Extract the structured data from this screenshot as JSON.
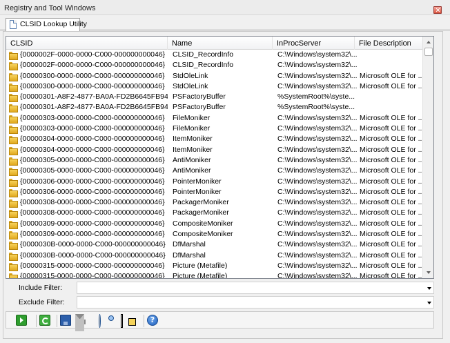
{
  "window": {
    "title": "Registry and Tool Windows"
  },
  "tabs": [
    {
      "label": "CLSID Lookup Utility"
    }
  ],
  "grid": {
    "columns": [
      "CLSID",
      "Name",
      "InProcServer",
      "File Description"
    ],
    "rows": [
      [
        "{0000002F-0000-0000-C000-000000000046}",
        "CLSID_RecordInfo",
        "C:\\Windows\\system32\\...",
        ""
      ],
      [
        "{0000002F-0000-0000-C000-000000000046}",
        "CLSID_RecordInfo",
        "C:\\Windows\\system32\\...",
        ""
      ],
      [
        "{00000300-0000-0000-C000-000000000046}",
        "StdOleLink",
        "C:\\Windows\\system32\\...",
        "Microsoft OLE for ..."
      ],
      [
        "{00000300-0000-0000-C000-000000000046}",
        "StdOleLink",
        "C:\\Windows\\system32\\...",
        "Microsoft OLE for ..."
      ],
      [
        "{00000301-A8F2-4877-BA0A-FD2B6645FB94}",
        "PSFactoryBuffer",
        "%SystemRoot%\\syste...",
        ""
      ],
      [
        "{00000301-A8F2-4877-BA0A-FD2B6645FB94}",
        "PSFactoryBuffer",
        "%SystemRoot%\\syste...",
        ""
      ],
      [
        "{00000303-0000-0000-C000-000000000046}",
        "FileMoniker",
        "C:\\Windows\\system32\\...",
        "Microsoft OLE for ..."
      ],
      [
        "{00000303-0000-0000-C000-000000000046}",
        "FileMoniker",
        "C:\\Windows\\system32\\...",
        "Microsoft OLE for ..."
      ],
      [
        "{00000304-0000-0000-C000-000000000046}",
        "ItemMoniker",
        "C:\\Windows\\system32\\...",
        "Microsoft OLE for ..."
      ],
      [
        "{00000304-0000-0000-C000-000000000046}",
        "ItemMoniker",
        "C:\\Windows\\system32\\...",
        "Microsoft OLE for ..."
      ],
      [
        "{00000305-0000-0000-C000-000000000046}",
        "AntiMoniker",
        "C:\\Windows\\system32\\...",
        "Microsoft OLE for ..."
      ],
      [
        "{00000305-0000-0000-C000-000000000046}",
        "AntiMoniker",
        "C:\\Windows\\system32\\...",
        "Microsoft OLE for ..."
      ],
      [
        "{00000306-0000-0000-C000-000000000046}",
        "PointerMoniker",
        "C:\\Windows\\system32\\...",
        "Microsoft OLE for ..."
      ],
      [
        "{00000306-0000-0000-C000-000000000046}",
        "PointerMoniker",
        "C:\\Windows\\system32\\...",
        "Microsoft OLE for ..."
      ],
      [
        "{00000308-0000-0000-C000-000000000046}",
        "PackagerMoniker",
        "C:\\Windows\\system32\\...",
        "Microsoft OLE for ..."
      ],
      [
        "{00000308-0000-0000-C000-000000000046}",
        "PackagerMoniker",
        "C:\\Windows\\system32\\...",
        "Microsoft OLE for ..."
      ],
      [
        "{00000309-0000-0000-C000-000000000046}",
        "CompositeMoniker",
        "C:\\Windows\\system32\\...",
        "Microsoft OLE for ..."
      ],
      [
        "{00000309-0000-0000-C000-000000000046}",
        "CompositeMoniker",
        "C:\\Windows\\system32\\...",
        "Microsoft OLE for ..."
      ],
      [
        "{0000030B-0000-0000-C000-000000000046}",
        "DfMarshal",
        "C:\\Windows\\system32\\...",
        "Microsoft OLE for ..."
      ],
      [
        "{0000030B-0000-0000-C000-000000000046}",
        "DfMarshal",
        "C:\\Windows\\system32\\...",
        "Microsoft OLE for ..."
      ],
      [
        "{00000315-0000-0000-C000-000000000046}",
        "Picture (Metafile)",
        "C:\\Windows\\system32\\...",
        "Microsoft OLE for ..."
      ],
      [
        "{00000315-0000-0000-C000-000000000046}",
        "Picture (Metafile)",
        "C:\\Windows\\system32\\...",
        "Microsoft OLE for ..."
      ]
    ]
  },
  "filters": {
    "include": {
      "label": "Include Filter:",
      "value": ""
    },
    "exclude": {
      "label": "Exclude Filter:",
      "value": ""
    }
  },
  "toolbar": {
    "icons": [
      "run-icon",
      "refresh-icon",
      "save-icon",
      "filter-icon",
      "connect-icon",
      "windows-icon",
      "help-icon"
    ],
    "help_glyph": "?"
  }
}
